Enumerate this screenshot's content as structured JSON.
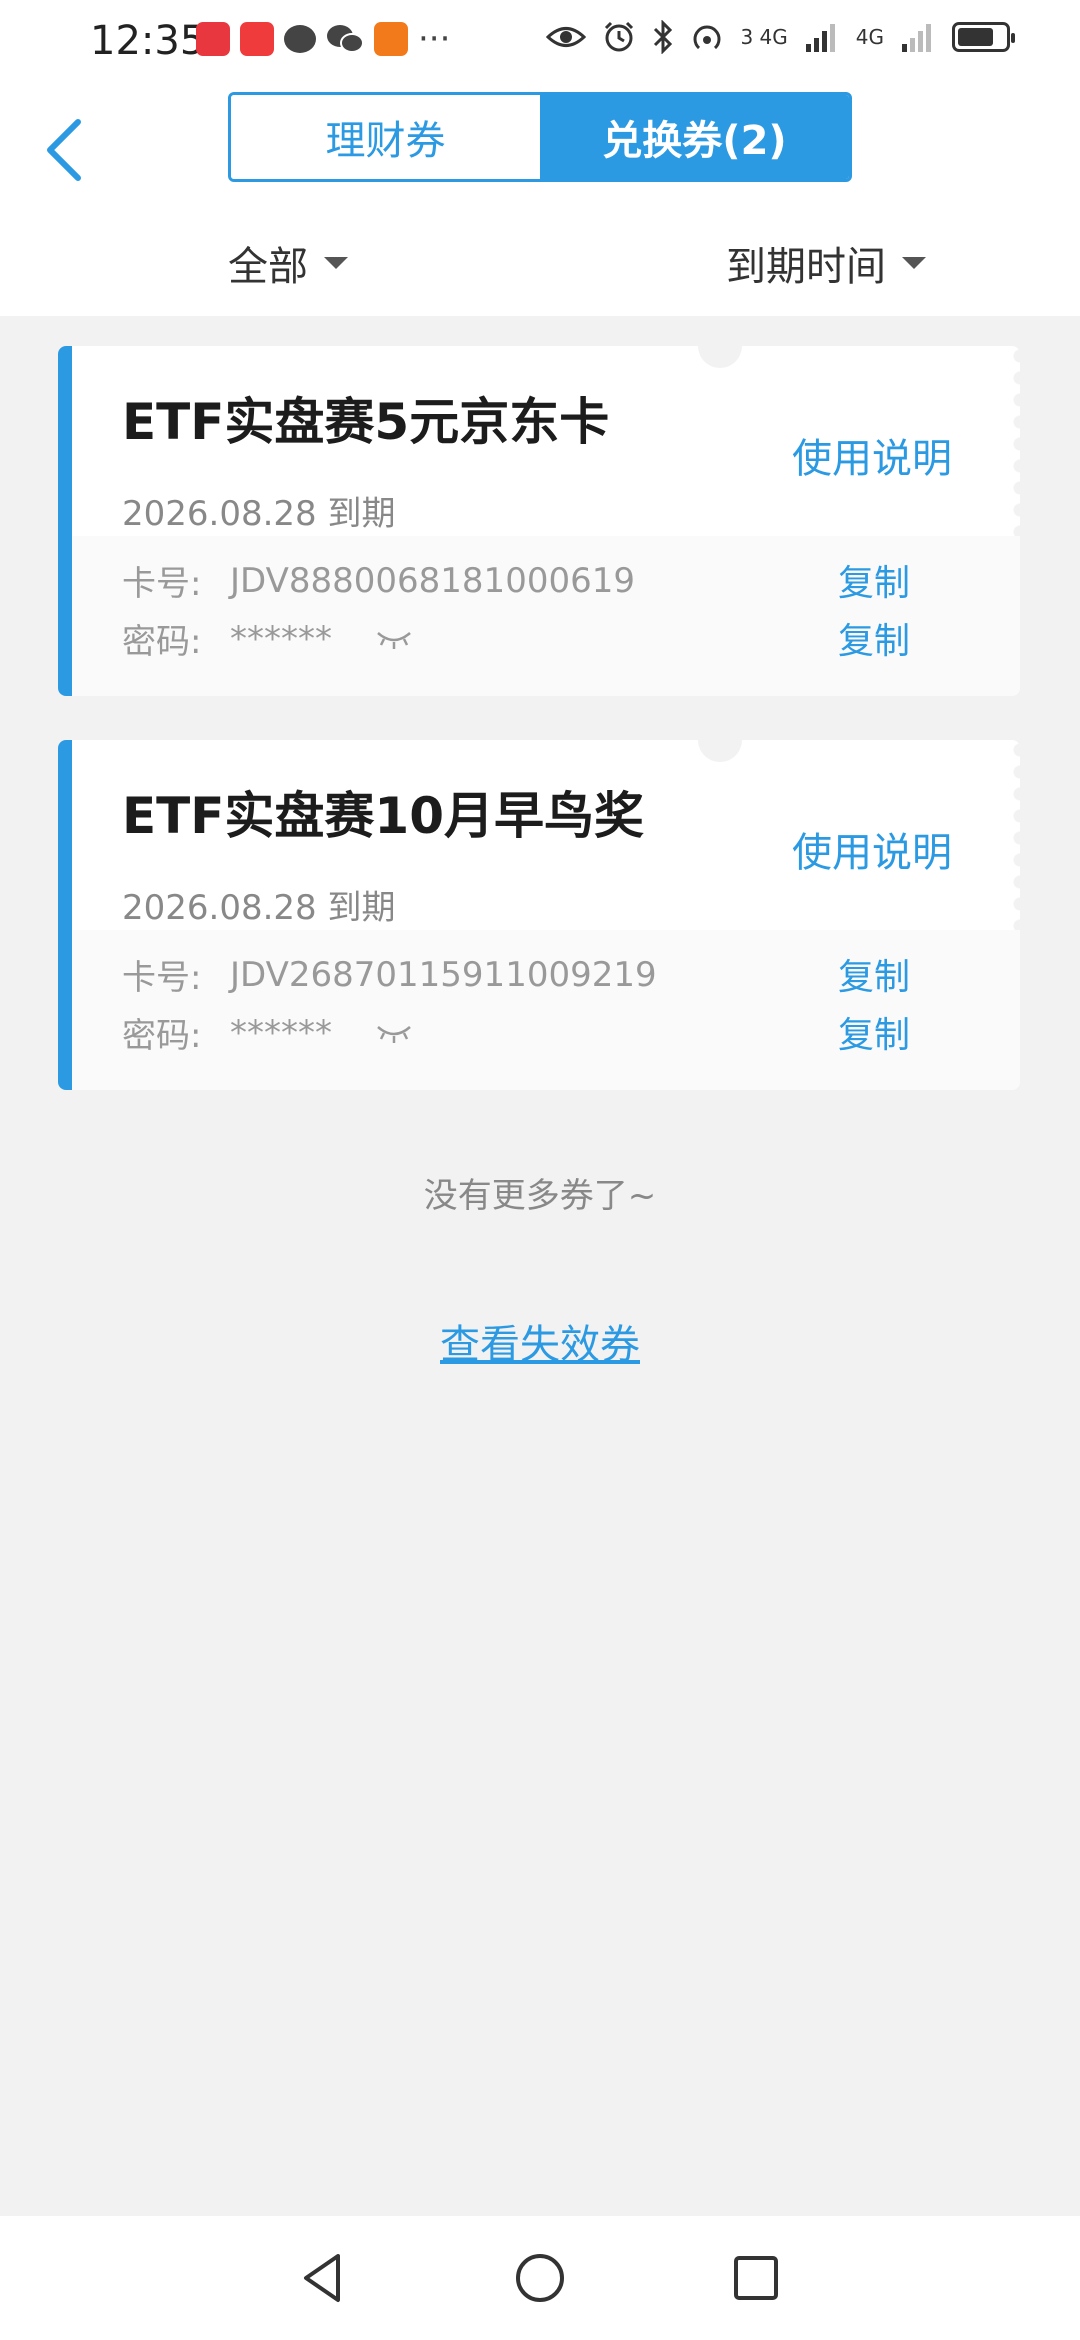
{
  "status_bar": {
    "time": "12:35",
    "dots": "···",
    "signal1": "3 4G",
    "signal2": "4G",
    "battery_level": 0.75,
    "icons": [
      "news-app-icon",
      "huawei-app-icon",
      "message-icon",
      "wechat-icon",
      "orange-app-icon",
      "eye-comfort-icon",
      "alarm-icon",
      "bluetooth-icon",
      "hotspot-icon",
      "signal-icon",
      "battery-icon"
    ]
  },
  "header": {
    "tabs": [
      {
        "label": "理财券",
        "active": false
      },
      {
        "label": "兑换券(2)",
        "active": true
      }
    ],
    "filters": {
      "category": "全部",
      "sort": "到期时间"
    }
  },
  "coupons": [
    {
      "title": "ETF实盘赛5元京东卡",
      "expiry": "2026.08.28 到期",
      "usage_label": "使用说明",
      "card_label": "卡号:",
      "card_number": "JDV8880068181000619",
      "password_label": "密码:",
      "password": "******",
      "copy_label": "复制"
    },
    {
      "title": "ETF实盘赛10月早鸟奖",
      "expiry": "2026.08.28 到期",
      "usage_label": "使用说明",
      "card_label": "卡号:",
      "card_number": "JDV26870115911009219",
      "password_label": "密码:",
      "password": "******",
      "copy_label": "复制"
    }
  ],
  "footer": {
    "no_more": "没有更多券了~",
    "view_expired": "查看失效券"
  },
  "colors": {
    "accent": "#2b9ae3",
    "background": "#f2f2f2"
  }
}
